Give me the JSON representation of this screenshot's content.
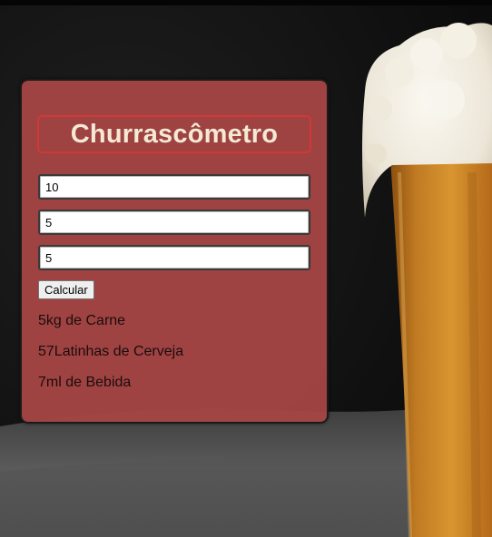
{
  "app": {
    "title": "Churrascômetro"
  },
  "form": {
    "adults": {
      "value": "10"
    },
    "children": {
      "value": "5"
    },
    "duration": {
      "value": "5"
    },
    "calculate_label": "Calcular"
  },
  "results": {
    "meat": "5kg de Carne",
    "beer": "57Latinhas de Cerveja",
    "drinks": "7ml de Bebida"
  },
  "colors": {
    "panel": "#a54444",
    "title_text": "#f4e9d4",
    "title_border": "#d23838",
    "beer": "#c27a1f",
    "foam": "#f2efe8"
  }
}
